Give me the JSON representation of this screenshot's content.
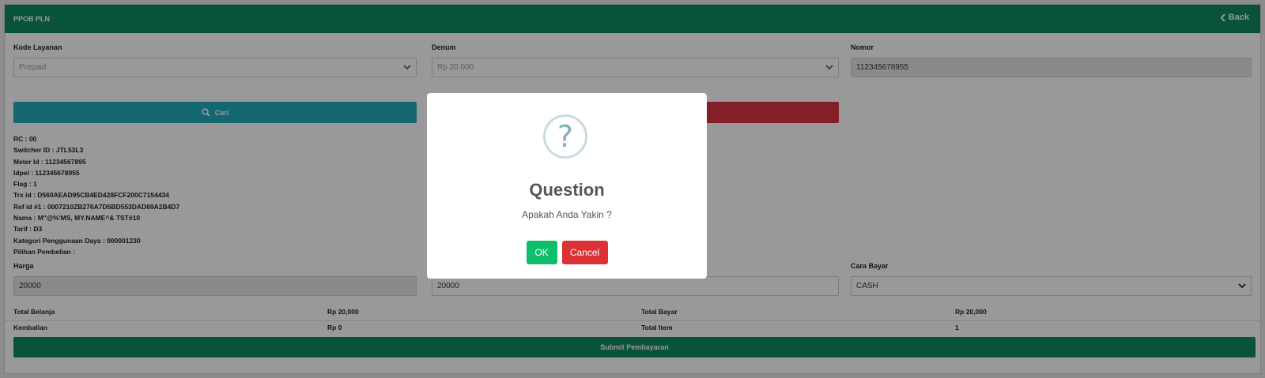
{
  "header": {
    "title": "PPOB PLN",
    "back_label": "Back"
  },
  "form": {
    "kode_layanan_label": "Kode Layanan",
    "kode_layanan_value": "Prepaid",
    "denum_label": "Denum",
    "denum_value": "Rp 20.000",
    "nomor_label": "Nomor",
    "nomor_value": "112345678955",
    "cari_label": "Cari"
  },
  "info_lines": [
    "RC : 00",
    "Switcher ID : JTL53L3",
    "Meter Id : 11234567895",
    "Idpel : 112345678955",
    "Flag : 1",
    "Trx id : D560AEAD95CB4ED428FCF200C7154434",
    "Ref id #1 : 0007210ZB276A7D5BD553DAD69A2B4D7",
    "Nama : M\"@%'MS, MY.NAME^& TST#10",
    "Tarif : D3",
    "Kategori Penggunaan Daya : 000001230",
    "Pilihan Pembelian :"
  ],
  "payment": {
    "harga_label": "Harga",
    "harga_value": "20000",
    "second_value": "20000",
    "cara_bayar_label": "Cara Bayar",
    "cara_bayar_value": "CASH"
  },
  "summary": {
    "total_belanja_label": "Total Belanja",
    "total_belanja_value": "Rp 20,000",
    "total_bayar_label": "Total Bayar",
    "total_bayar_value": "Rp 20,000",
    "kembalian_label": "Kembalian",
    "kembalian_value": "Rp 0",
    "total_item_label": "Total Item",
    "total_item_value": "1"
  },
  "submit_label": "Submit Pembayaran",
  "dialog": {
    "icon_glyph": "?",
    "title": "Question",
    "message": "Apakah Anda Yakin ?",
    "ok_label": "OK",
    "cancel_label": "Cancel"
  },
  "colors": {
    "header_green": "#0e8a5f",
    "cari_blue": "#22aabd",
    "danger_red": "#dc3545",
    "ok_green": "#0ebe6a"
  }
}
